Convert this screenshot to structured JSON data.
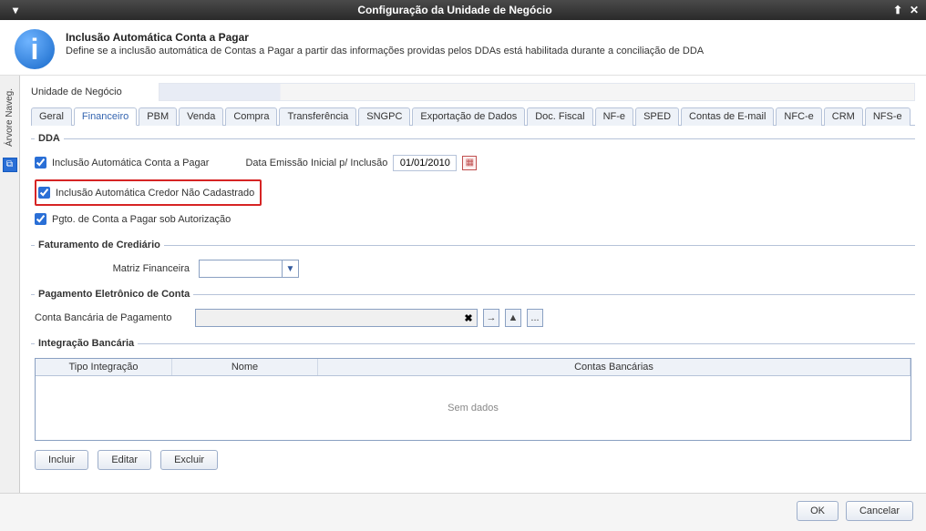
{
  "titlebar": {
    "title": "Configuração da Unidade de Negócio",
    "min": "▾",
    "up": "⬆",
    "close": "✕"
  },
  "header": {
    "icon": "i",
    "title": "Inclusão Automática Conta a Pagar",
    "subtitle": "Define se a inclusão automática de Contas a Pagar a partir das informações providas pelos DDAs está habilitada durante a conciliação de DDA"
  },
  "side": {
    "label": "Árvore Naveg.",
    "handle_icon": "⧉"
  },
  "business_unit": {
    "label": "Unidade de Negócio"
  },
  "tabs": [
    "Geral",
    "Financeiro",
    "PBM",
    "Venda",
    "Compra",
    "Transferência",
    "SNGPC",
    "Exportação de Dados",
    "Doc. Fiscal",
    "NF-e",
    "SPED",
    "Contas de E-mail",
    "NFC-e",
    "CRM",
    "NFS-e"
  ],
  "active_tab_index": 1,
  "dda": {
    "legend": "DDA",
    "ck_incl_auto": "Inclusão Automática Conta a Pagar",
    "date_label": "Data Emissão Inicial p/ Inclusão",
    "date_value": "01/01/2010",
    "ck_credor": "Inclusão Automática Credor Não Cadastrado",
    "ck_pgto": "Pgto. de Conta a Pagar sob Autorização"
  },
  "faturamento": {
    "legend": "Faturamento de Crediário",
    "matriz_label": "Matriz Financeira"
  },
  "pagamento": {
    "legend": "Pagamento Eletrônico de Conta",
    "conta_label": "Conta Bancária de Pagamento"
  },
  "integracao": {
    "legend": "Integração Bancária",
    "headers": {
      "tipo": "Tipo Integração",
      "nome": "Nome",
      "contas": "Contas Bancárias"
    },
    "empty": "Sem dados",
    "buttons": {
      "incluir": "Incluir",
      "editar": "Editar",
      "excluir": "Excluir"
    }
  },
  "footer": {
    "ok": "OK",
    "cancel": "Cancelar"
  },
  "icons": {
    "arrow_down": "▼",
    "arrow_right": "→",
    "arrow_up": "▲",
    "dots": "...",
    "clear": "✖",
    "cal": "📅"
  }
}
